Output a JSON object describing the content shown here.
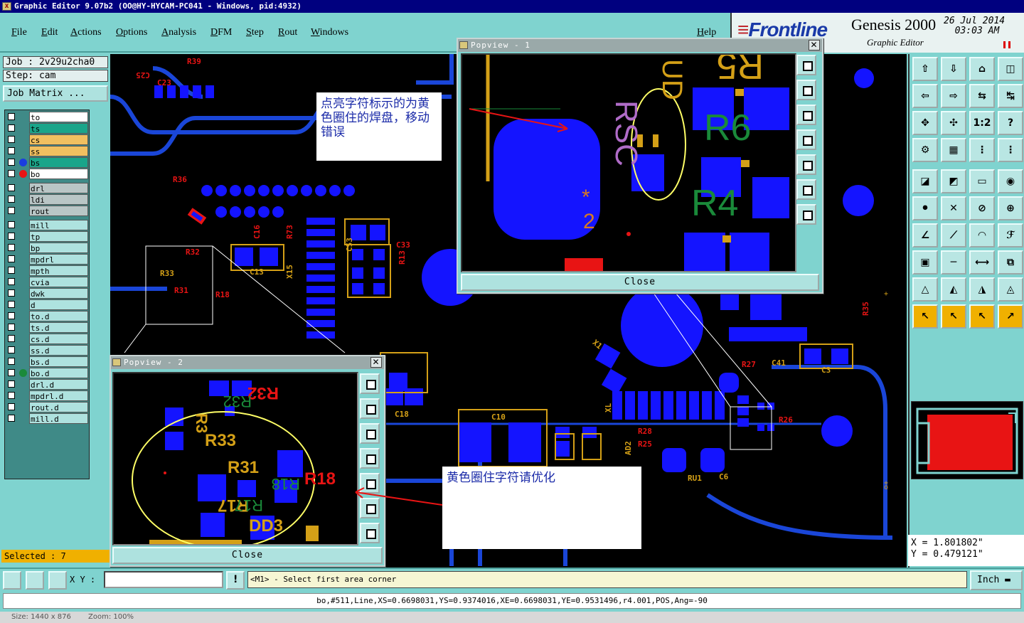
{
  "window": {
    "title": "Graphic Editor 9.07b2 (OO@HY-HYCAM-PC041 - Windows, pid:4932)"
  },
  "menu": [
    "File",
    "Edit",
    "Actions",
    "Options",
    "Analysis",
    "DFM",
    "Step",
    "Rout",
    "Windows"
  ],
  "help_label": "Help",
  "brand": {
    "logo": "Frontline",
    "product": "Genesis 2000",
    "subtitle": "Graphic Editor",
    "date": "26 Jul 2014",
    "time": "03:03 AM"
  },
  "job": {
    "job_label": "Job : 2v29u2cha0",
    "step_label": "Step: cam",
    "matrix_label": "Job Matrix ..."
  },
  "layers": [
    {
      "name": "to",
      "bg": "#ffffff"
    },
    {
      "name": "ts",
      "bg": "#1aa58a"
    },
    {
      "name": "cs",
      "bg": "#f1c060"
    },
    {
      "name": "ss",
      "bg": "#f1c060"
    },
    {
      "name": "bs",
      "bg": "#1aa58a",
      "dot": "#1a3de0"
    },
    {
      "name": "bo",
      "bg": "#ffffff",
      "dot": "#e81414"
    },
    {
      "name": "drl",
      "bg": "#b9c6c6"
    },
    {
      "name": "ldi",
      "bg": "#b9c6c6"
    },
    {
      "name": "rout",
      "bg": "#b9c6c6"
    },
    {
      "name": "mill",
      "bg": "#aee2df"
    },
    {
      "name": "tp",
      "bg": "#aee2df"
    },
    {
      "name": "bp",
      "bg": "#aee2df"
    },
    {
      "name": "mpdrl",
      "bg": "#aee2df"
    },
    {
      "name": "mpth",
      "bg": "#aee2df"
    },
    {
      "name": "cvia",
      "bg": "#aee2df"
    },
    {
      "name": "dwk",
      "bg": "#aee2df"
    },
    {
      "name": "d",
      "bg": "#aee2df"
    },
    {
      "name": "to.d",
      "bg": "#aee2df"
    },
    {
      "name": "ts.d",
      "bg": "#aee2df"
    },
    {
      "name": "cs.d",
      "bg": "#aee2df"
    },
    {
      "name": "ss.d",
      "bg": "#aee2df"
    },
    {
      "name": "bs.d",
      "bg": "#aee2df"
    },
    {
      "name": "bo.d",
      "bg": "#aee2df",
      "dot": "#1a8a3a"
    },
    {
      "name": "drl.d",
      "bg": "#aee2df"
    },
    {
      "name": "mpdrl.d",
      "bg": "#aee2df"
    },
    {
      "name": "rout.d",
      "bg": "#aee2df"
    },
    {
      "name": "mill.d",
      "bg": "#aee2df"
    }
  ],
  "selected_label": "Selected : 7",
  "popview1": {
    "title": "Popview - 1",
    "close_label": "Close"
  },
  "popview2": {
    "title": "Popview - 2",
    "close_label": "Close"
  },
  "annotations": {
    "note1": "点亮字符标示的为黄色圈住的焊盘，移动错误",
    "note2": "黄色圈住字符请优化"
  },
  "canvas_labels": [
    "C25",
    "C23",
    "R39",
    "R36",
    "C16",
    "R73",
    "R32",
    "R33",
    "R31",
    "R18",
    "C13",
    "C33",
    "C53",
    "R13",
    "X15",
    "C18",
    "C10",
    "X1",
    "R27",
    "C41",
    "C3",
    "R26",
    "R28",
    "R25",
    "XL",
    "AD2",
    "RU1",
    "C6",
    "R35"
  ],
  "pop1_labels": [
    "R6",
    "R4",
    "R5"
  ],
  "pop2_labels": [
    "R32",
    "R33",
    "R31",
    "R18",
    "R17",
    "DD3"
  ],
  "coords": {
    "x": "X = 1.801802\"",
    "y": "Y = 0.479121\""
  },
  "cmd": {
    "xy_label": "X Y :",
    "xy_value": "",
    "prompt": "<M1> - Select first area corner",
    "units": "Inch"
  },
  "status": "bo,#511,Line,XS=0.6698031,YS=0.9374016,XE=0.6698031,YE=0.9531496,r4.001,POS,Ang=-90",
  "footer": {
    "size": "Size: 1440 x 876",
    "zoom": "Zoom: 100%"
  },
  "colors": {
    "pad": "#1414ff",
    "silk_red": "#e81414",
    "silk_yellow": "#d4a017",
    "trace": "#1a46d8"
  }
}
